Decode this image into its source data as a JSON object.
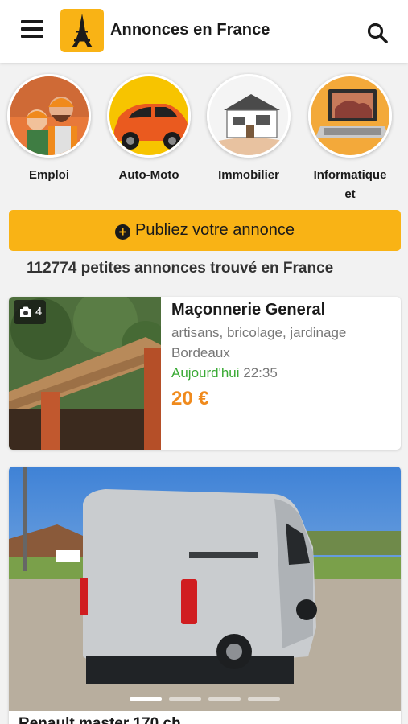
{
  "header": {
    "title": "Annonces en France",
    "menu_icon": "hamburger-menu-icon",
    "logo_icon": "eiffel-tower-icon",
    "search_icon": "search-icon"
  },
  "categories": [
    {
      "label": "Emploi",
      "icon": "workers-photo"
    },
    {
      "label": "Auto-Moto",
      "icon": "car-photo"
    },
    {
      "label": "Immobilier",
      "icon": "house-photo"
    },
    {
      "label": "Informatique",
      "label_line2": "et",
      "icon": "laptop-photo"
    }
  ],
  "publish_button": {
    "label": "Publiez votre annonce"
  },
  "results": {
    "count_text": "112774 petites annonces trouvé en France"
  },
  "listings": [
    {
      "photo_count": "4",
      "title": "Maçonnerie General",
      "category": "artisans, bricolage, jardinage",
      "city": "Bordeaux",
      "date_day": "Aujourd'hui",
      "date_time": "22:35",
      "price": "20 €"
    },
    {
      "title": "Renault master 170 ch",
      "slides": 4,
      "active_slide": 1
    }
  ],
  "colors": {
    "accent": "#f9b315",
    "price": "#f08a1c",
    "today": "#3aaa35"
  }
}
